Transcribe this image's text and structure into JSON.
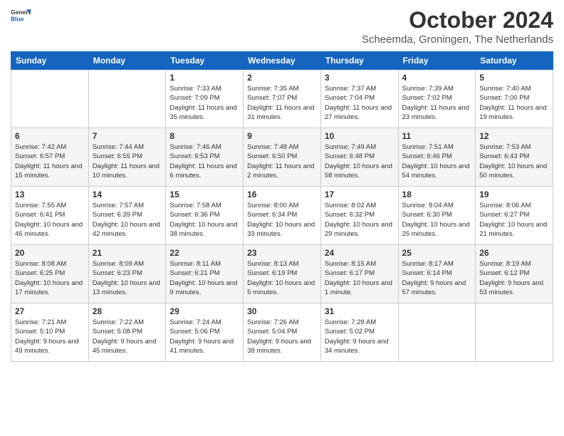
{
  "header": {
    "logo_general": "General",
    "logo_blue": "Blue",
    "month_title": "October 2024",
    "subtitle": "Scheemda, Groningen, The Netherlands"
  },
  "days_of_week": [
    "Sunday",
    "Monday",
    "Tuesday",
    "Wednesday",
    "Thursday",
    "Friday",
    "Saturday"
  ],
  "weeks": [
    [
      {
        "day": null
      },
      {
        "day": null
      },
      {
        "day": 1,
        "sunrise": "Sunrise: 7:33 AM",
        "sunset": "Sunset: 7:09 PM",
        "daylight": "Daylight: 11 hours and 35 minutes."
      },
      {
        "day": 2,
        "sunrise": "Sunrise: 7:35 AM",
        "sunset": "Sunset: 7:07 PM",
        "daylight": "Daylight: 11 hours and 31 minutes."
      },
      {
        "day": 3,
        "sunrise": "Sunrise: 7:37 AM",
        "sunset": "Sunset: 7:04 PM",
        "daylight": "Daylight: 11 hours and 27 minutes."
      },
      {
        "day": 4,
        "sunrise": "Sunrise: 7:39 AM",
        "sunset": "Sunset: 7:02 PM",
        "daylight": "Daylight: 11 hours and 23 minutes."
      },
      {
        "day": 5,
        "sunrise": "Sunrise: 7:40 AM",
        "sunset": "Sunset: 7:00 PM",
        "daylight": "Daylight: 11 hours and 19 minutes."
      }
    ],
    [
      {
        "day": 6,
        "sunrise": "Sunrise: 7:42 AM",
        "sunset": "Sunset: 6:57 PM",
        "daylight": "Daylight: 11 hours and 15 minutes."
      },
      {
        "day": 7,
        "sunrise": "Sunrise: 7:44 AM",
        "sunset": "Sunset: 6:55 PM",
        "daylight": "Daylight: 11 hours and 10 minutes."
      },
      {
        "day": 8,
        "sunrise": "Sunrise: 7:46 AM",
        "sunset": "Sunset: 6:53 PM",
        "daylight": "Daylight: 11 hours and 6 minutes."
      },
      {
        "day": 9,
        "sunrise": "Sunrise: 7:48 AM",
        "sunset": "Sunset: 6:50 PM",
        "daylight": "Daylight: 11 hours and 2 minutes."
      },
      {
        "day": 10,
        "sunrise": "Sunrise: 7:49 AM",
        "sunset": "Sunset: 6:48 PM",
        "daylight": "Daylight: 10 hours and 58 minutes."
      },
      {
        "day": 11,
        "sunrise": "Sunrise: 7:51 AM",
        "sunset": "Sunset: 6:46 PM",
        "daylight": "Daylight: 10 hours and 54 minutes."
      },
      {
        "day": 12,
        "sunrise": "Sunrise: 7:53 AM",
        "sunset": "Sunset: 6:43 PM",
        "daylight": "Daylight: 10 hours and 50 minutes."
      }
    ],
    [
      {
        "day": 13,
        "sunrise": "Sunrise: 7:55 AM",
        "sunset": "Sunset: 6:41 PM",
        "daylight": "Daylight: 10 hours and 46 minutes."
      },
      {
        "day": 14,
        "sunrise": "Sunrise: 7:57 AM",
        "sunset": "Sunset: 6:39 PM",
        "daylight": "Daylight: 10 hours and 42 minutes."
      },
      {
        "day": 15,
        "sunrise": "Sunrise: 7:58 AM",
        "sunset": "Sunset: 6:36 PM",
        "daylight": "Daylight: 10 hours and 38 minutes."
      },
      {
        "day": 16,
        "sunrise": "Sunrise: 8:00 AM",
        "sunset": "Sunset: 6:34 PM",
        "daylight": "Daylight: 10 hours and 33 minutes."
      },
      {
        "day": 17,
        "sunrise": "Sunrise: 8:02 AM",
        "sunset": "Sunset: 6:32 PM",
        "daylight": "Daylight: 10 hours and 29 minutes."
      },
      {
        "day": 18,
        "sunrise": "Sunrise: 8:04 AM",
        "sunset": "Sunset: 6:30 PM",
        "daylight": "Daylight: 10 hours and 25 minutes."
      },
      {
        "day": 19,
        "sunrise": "Sunrise: 8:06 AM",
        "sunset": "Sunset: 6:27 PM",
        "daylight": "Daylight: 10 hours and 21 minutes."
      }
    ],
    [
      {
        "day": 20,
        "sunrise": "Sunrise: 8:08 AM",
        "sunset": "Sunset: 6:25 PM",
        "daylight": "Daylight: 10 hours and 17 minutes."
      },
      {
        "day": 21,
        "sunrise": "Sunrise: 8:09 AM",
        "sunset": "Sunset: 6:23 PM",
        "daylight": "Daylight: 10 hours and 13 minutes."
      },
      {
        "day": 22,
        "sunrise": "Sunrise: 8:11 AM",
        "sunset": "Sunset: 6:21 PM",
        "daylight": "Daylight: 10 hours and 9 minutes."
      },
      {
        "day": 23,
        "sunrise": "Sunrise: 8:13 AM",
        "sunset": "Sunset: 6:19 PM",
        "daylight": "Daylight: 10 hours and 5 minutes."
      },
      {
        "day": 24,
        "sunrise": "Sunrise: 8:15 AM",
        "sunset": "Sunset: 6:17 PM",
        "daylight": "Daylight: 10 hours and 1 minute."
      },
      {
        "day": 25,
        "sunrise": "Sunrise: 8:17 AM",
        "sunset": "Sunset: 6:14 PM",
        "daylight": "Daylight: 9 hours and 57 minutes."
      },
      {
        "day": 26,
        "sunrise": "Sunrise: 8:19 AM",
        "sunset": "Sunset: 6:12 PM",
        "daylight": "Daylight: 9 hours and 53 minutes."
      }
    ],
    [
      {
        "day": 27,
        "sunrise": "Sunrise: 7:21 AM",
        "sunset": "Sunset: 5:10 PM",
        "daylight": "Daylight: 9 hours and 49 minutes."
      },
      {
        "day": 28,
        "sunrise": "Sunrise: 7:22 AM",
        "sunset": "Sunset: 5:08 PM",
        "daylight": "Daylight: 9 hours and 45 minutes."
      },
      {
        "day": 29,
        "sunrise": "Sunrise: 7:24 AM",
        "sunset": "Sunset: 5:06 PM",
        "daylight": "Daylight: 9 hours and 41 minutes."
      },
      {
        "day": 30,
        "sunrise": "Sunrise: 7:26 AM",
        "sunset": "Sunset: 5:04 PM",
        "daylight": "Daylight: 9 hours and 38 minutes."
      },
      {
        "day": 31,
        "sunrise": "Sunrise: 7:28 AM",
        "sunset": "Sunset: 5:02 PM",
        "daylight": "Daylight: 9 hours and 34 minutes."
      },
      {
        "day": null
      },
      {
        "day": null
      }
    ]
  ]
}
